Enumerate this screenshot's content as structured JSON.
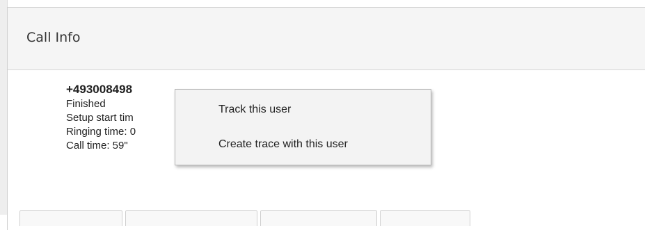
{
  "panel": {
    "title": "Call Info"
  },
  "call": {
    "number": "+493008498",
    "status": "Finished",
    "setup_start": "Setup start tim",
    "ringing": "Ringing time: 0",
    "call_time": "Call time: 59\""
  },
  "context_menu": {
    "items": [
      {
        "label": "Track this user"
      },
      {
        "label": "Create trace with this user"
      }
    ]
  },
  "tabs": [
    "",
    "",
    "",
    ""
  ]
}
